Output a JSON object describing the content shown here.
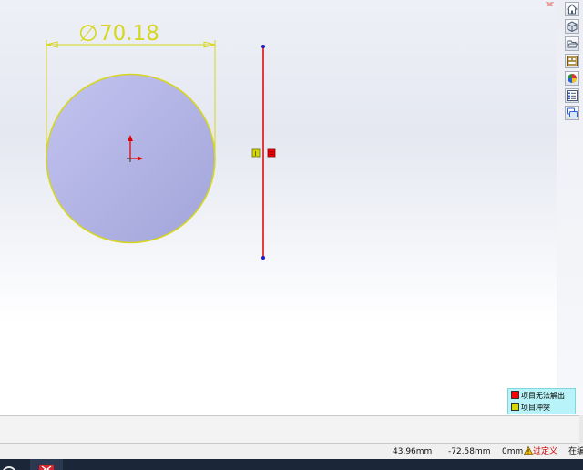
{
  "sketch": {
    "dimension_symbol": "∅",
    "dimension_value": "70.18",
    "relation_markers": [
      "I",
      "="
    ]
  },
  "legend": {
    "items": [
      {
        "label": "项目无法解出",
        "color": "#ff0000"
      },
      {
        "label": "项目冲突",
        "color": "#d7d700"
      }
    ]
  },
  "statusbar": {
    "x": "43.96mm",
    "y": "-72.58mm",
    "z": "0mm",
    "state": "过定义",
    "extra": "在编"
  },
  "taskpane": {
    "icons": [
      "home-icon",
      "parts-library-icon",
      "open-folder-icon",
      "view-palette-icon",
      "appearances-icon",
      "custom-properties-icon",
      "forum-icon"
    ]
  },
  "colors": {
    "circle_fill": "#a9acdf",
    "dimension": "#d6d61e",
    "line": "#e00000",
    "endpoint": "#1a1acc",
    "conflict_red": "#ff0000",
    "conflict_yellow": "#d7d700",
    "legend_bg": "#b7f3f8"
  }
}
